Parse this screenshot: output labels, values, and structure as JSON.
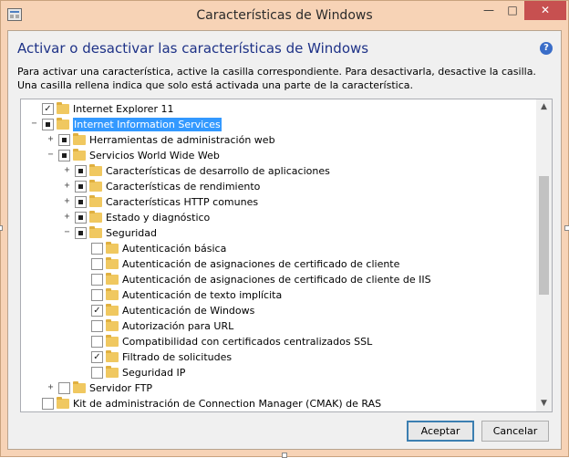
{
  "window": {
    "title": "Características de Windows",
    "controls": {
      "minimize": "—",
      "maximize": "□",
      "close": "✕"
    }
  },
  "heading": "Activar o desactivar las características de Windows",
  "help_icon": "?",
  "description": "Para activar una característica, active la casilla correspondiente. Para desactivarla, desactive la casilla. Una casilla rellena indica que solo está activada una parte de la característica.",
  "tree": [
    {
      "label": "Internet Explorer 11",
      "state": "checked",
      "expander": "",
      "level": 0
    },
    {
      "label": "Internet Information Services",
      "state": "partial",
      "expander": "minus",
      "level": 0,
      "selected": true
    },
    {
      "label": "Herramientas de administración web",
      "state": "partial",
      "expander": "plus",
      "level": 1
    },
    {
      "label": "Servicios World Wide Web",
      "state": "partial",
      "expander": "minus",
      "level": 1
    },
    {
      "label": "Características de desarrollo de aplicaciones",
      "state": "partial",
      "expander": "plus",
      "level": 2
    },
    {
      "label": "Características de rendimiento",
      "state": "partial",
      "expander": "plus",
      "level": 2
    },
    {
      "label": "Características HTTP comunes",
      "state": "partial",
      "expander": "plus",
      "level": 2
    },
    {
      "label": "Estado y diagnóstico",
      "state": "partial",
      "expander": "plus",
      "level": 2
    },
    {
      "label": "Seguridad",
      "state": "partial",
      "expander": "minus",
      "level": 2
    },
    {
      "label": "Autenticación básica",
      "state": "unchecked",
      "expander": "",
      "level": 3
    },
    {
      "label": "Autenticación de asignaciones de certificado de cliente",
      "state": "unchecked",
      "expander": "",
      "level": 3
    },
    {
      "label": "Autenticación de asignaciones de certificado de cliente de IIS",
      "state": "unchecked",
      "expander": "",
      "level": 3
    },
    {
      "label": "Autenticación de texto implícita",
      "state": "unchecked",
      "expander": "",
      "level": 3
    },
    {
      "label": "Autenticación de Windows",
      "state": "checked",
      "expander": "",
      "level": 3
    },
    {
      "label": "Autorización para URL",
      "state": "unchecked",
      "expander": "",
      "level": 3
    },
    {
      "label": "Compatibilidad con certificados centralizados SSL",
      "state": "unchecked",
      "expander": "",
      "level": 3
    },
    {
      "label": "Filtrado de solicitudes",
      "state": "checked",
      "expander": "",
      "level": 3
    },
    {
      "label": "Seguridad IP",
      "state": "unchecked",
      "expander": "",
      "level": 3
    },
    {
      "label": "Servidor FTP",
      "state": "unchecked",
      "expander": "plus",
      "level": 1
    },
    {
      "label": "Kit de administración de Connection Manager (CMAK) de RAS",
      "state": "unchecked",
      "expander": "",
      "level": 0
    }
  ],
  "buttons": {
    "ok": "Aceptar",
    "cancel": "Cancelar"
  }
}
